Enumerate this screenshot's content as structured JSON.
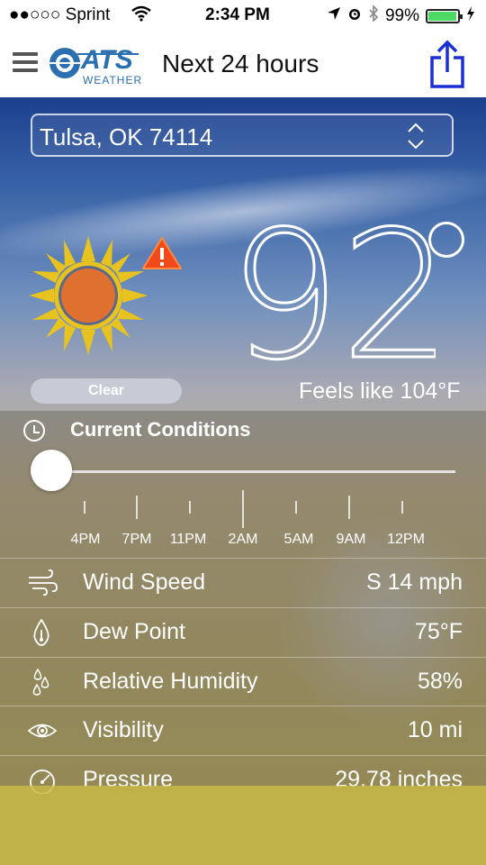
{
  "status_bar": {
    "carrier": "●●○○○ Sprint",
    "time": "2:34 PM",
    "battery": "99%",
    "battery_level": 0.99
  },
  "nav": {
    "logo_text": "ATS",
    "logo_subtext": "WEATHER",
    "title": "Next 24 hours",
    "icons": [
      "menu-icon",
      "share-icon"
    ]
  },
  "location": {
    "value": "Tulsa, OK 74114"
  },
  "current": {
    "temperature": "92",
    "degree_symbol": "°",
    "feels_like": "Feels like 104°F",
    "condition": "Clear",
    "icons": [
      "sun-icon",
      "warning-icon"
    ]
  },
  "conditions": {
    "title": "Current Conditions",
    "timeline": [
      "4PM",
      "7PM",
      "11PM",
      "2AM",
      "5AM",
      "9AM",
      "12PM"
    ],
    "slider_position": 0,
    "rows": [
      {
        "label": "Wind Speed",
        "value": "S 14 mph",
        "icon": "wind-icon"
      },
      {
        "label": "Dew Point",
        "value": "75°F",
        "icon": "droplet-icon"
      },
      {
        "label": "Relative Humidity",
        "value": "58%",
        "icon": "humidity-icon"
      },
      {
        "label": "Visibility",
        "value": "10 mi",
        "icon": "eye-icon"
      },
      {
        "label": "Pressure",
        "value": "29.78 inches",
        "icon": "gauge-icon"
      }
    ]
  },
  "colors": {
    "accent": "#1a2fd6",
    "battery": "#4cd964",
    "warning": "#f04a1a",
    "sun_ray": "#e8c21e",
    "sun_core": "#e07030"
  }
}
